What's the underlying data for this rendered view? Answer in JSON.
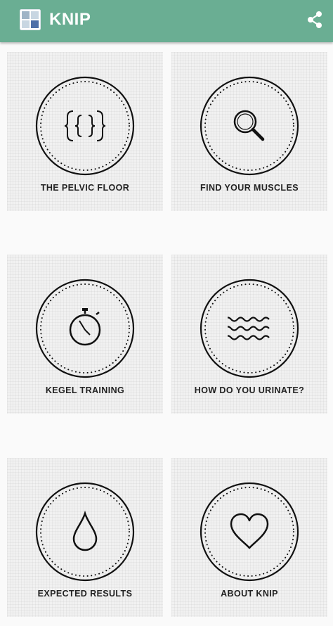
{
  "app": {
    "title": "KNIP",
    "logo_icon": "grid-logo-icon",
    "share_icon": "share-icon",
    "header_color": "#6aae93"
  },
  "menu": {
    "items": [
      {
        "label": "THE PELVIC FLOOR",
        "icon": "curly-brackets-icon"
      },
      {
        "label": "FIND YOUR MUSCLES",
        "icon": "magnifier-icon"
      },
      {
        "label": "KEGEL TRAINING",
        "icon": "stopwatch-icon"
      },
      {
        "label": "HOW DO YOU URINATE?",
        "icon": "waves-icon"
      },
      {
        "label": "EXPECTED RESULTS",
        "icon": "drop-icon"
      },
      {
        "label": "ABOUT KNIP",
        "icon": "heart-icon"
      }
    ]
  }
}
